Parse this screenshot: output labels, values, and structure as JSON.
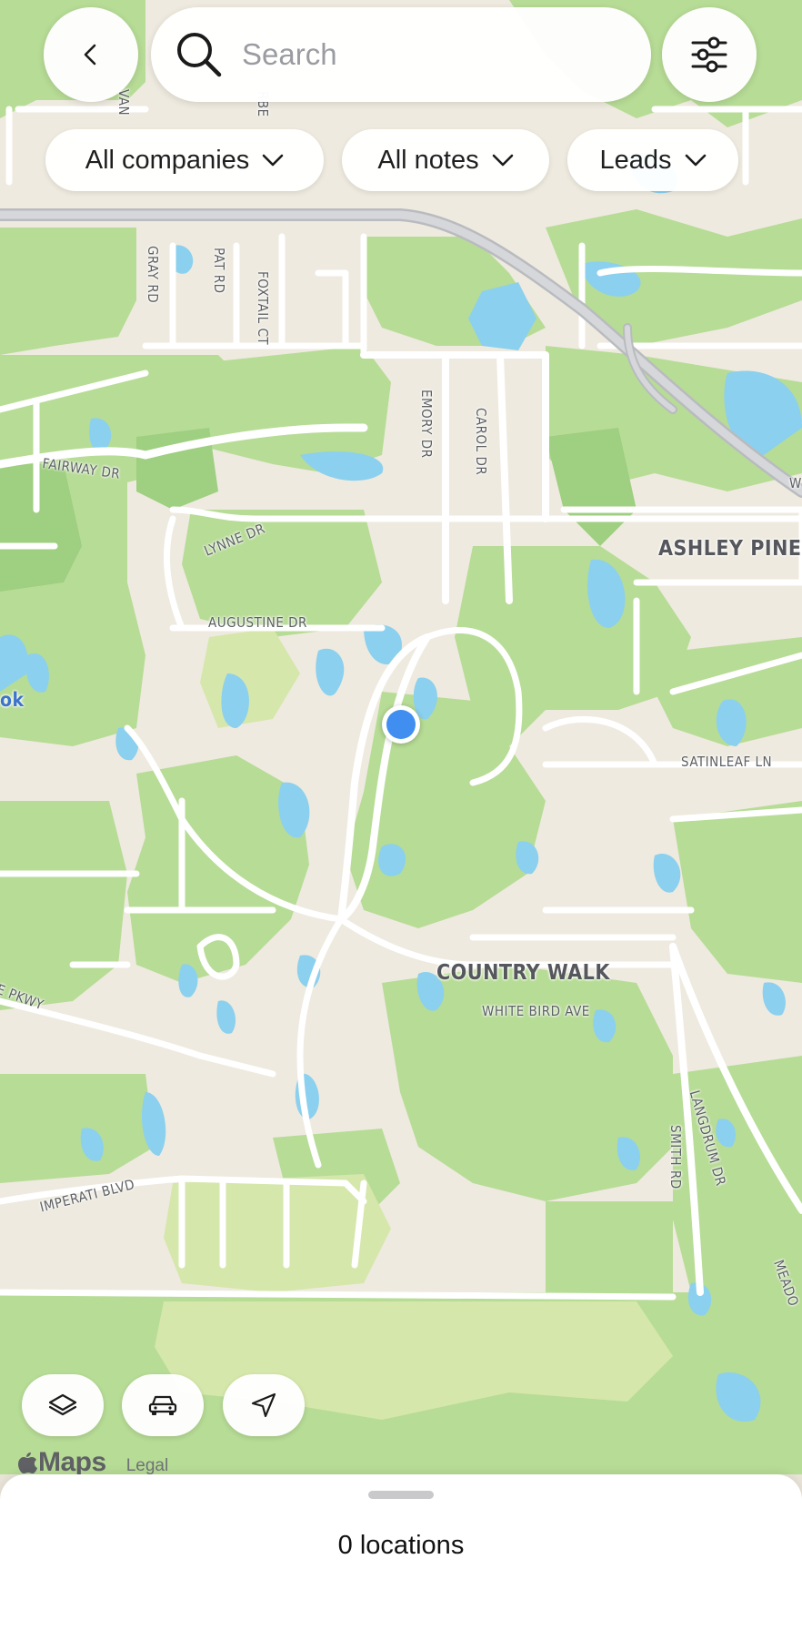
{
  "search": {
    "placeholder": "Search"
  },
  "filters": {
    "companies": "All companies",
    "notes": "All notes",
    "type": "Leads"
  },
  "map": {
    "street_labels": {
      "gray": "GRAY RD",
      "pat": "PAT RD",
      "foxtail": "FOXTAIL CT",
      "emory": "EMORY DR",
      "carol": "CAROL DR",
      "fairway": "FAIRWAY DR",
      "lynne": "LYNNE DR",
      "augustine": "AUGUSTINE DR",
      "satinleaf": "SATINLEAF LN",
      "white_bird": "WHITE BIRD AVE",
      "pkwy": "E PKWY",
      "imperati": "IMPERATI BLVD",
      "langdrum": "LANGDRUM DR",
      "smith": "SMITH RD",
      "meado": "MEADO",
      "van": "VAN",
      "rbe": "RBE",
      "w": "W"
    },
    "area_labels": {
      "ashley_pines": "ASHLEY PINES",
      "country_walk": "COUNTRY WALK"
    },
    "poi_fragment": "ok",
    "colors": {
      "land": "#eeeadf",
      "park": "#b7dc96",
      "park_dark": "#a4d184",
      "park_light": "#d7e8ad",
      "water": "#8bd0ee",
      "road": "#ffffff",
      "highway": "#c8cacd",
      "location_dot": "#3f8ef0"
    }
  },
  "attribution": {
    "maps": "Maps",
    "legal": "Legal"
  },
  "sheet": {
    "title": "0 locations"
  }
}
